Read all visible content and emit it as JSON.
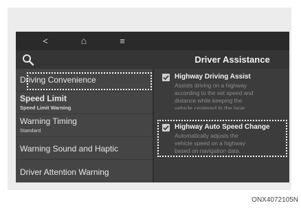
{
  "screen": {
    "nav": {
      "back_icon": "<",
      "home_icon": "⌂",
      "menu_icon": "≡"
    },
    "header": {
      "title": "Driver Assistance",
      "search_icon": "search-icon"
    },
    "menu": [
      {
        "label": "Driving Convenience",
        "sub": "",
        "highlighted": true
      },
      {
        "label": "Speed Limit",
        "sub": "Speed Limit Warning"
      },
      {
        "label": "Warning Timing",
        "sub": "Standard"
      },
      {
        "label": "Warning Sound and Haptic",
        "sub": ""
      },
      {
        "label": "Driver Attention Warning",
        "sub": ""
      }
    ],
    "options": [
      {
        "title": "Highway Driving Assist",
        "checked": true,
        "desc": [
          "Assists driving on a highway",
          "according to the set speed and",
          "distance while keeping the",
          "vehicle centered in the lane."
        ]
      },
      {
        "title": "Highway Auto Speed Change",
        "checked": true,
        "highlighted": true,
        "desc": [
          "Automatically adjusts the",
          "vehicle speed on a highway",
          "based on navigation data."
        ]
      }
    ]
  },
  "caption": "ONX4072105N",
  "colors": {
    "highlight_border": "#ffffff",
    "screen_bg": "#3c3c3c",
    "statusbar_bg": "#2a2a2a"
  }
}
